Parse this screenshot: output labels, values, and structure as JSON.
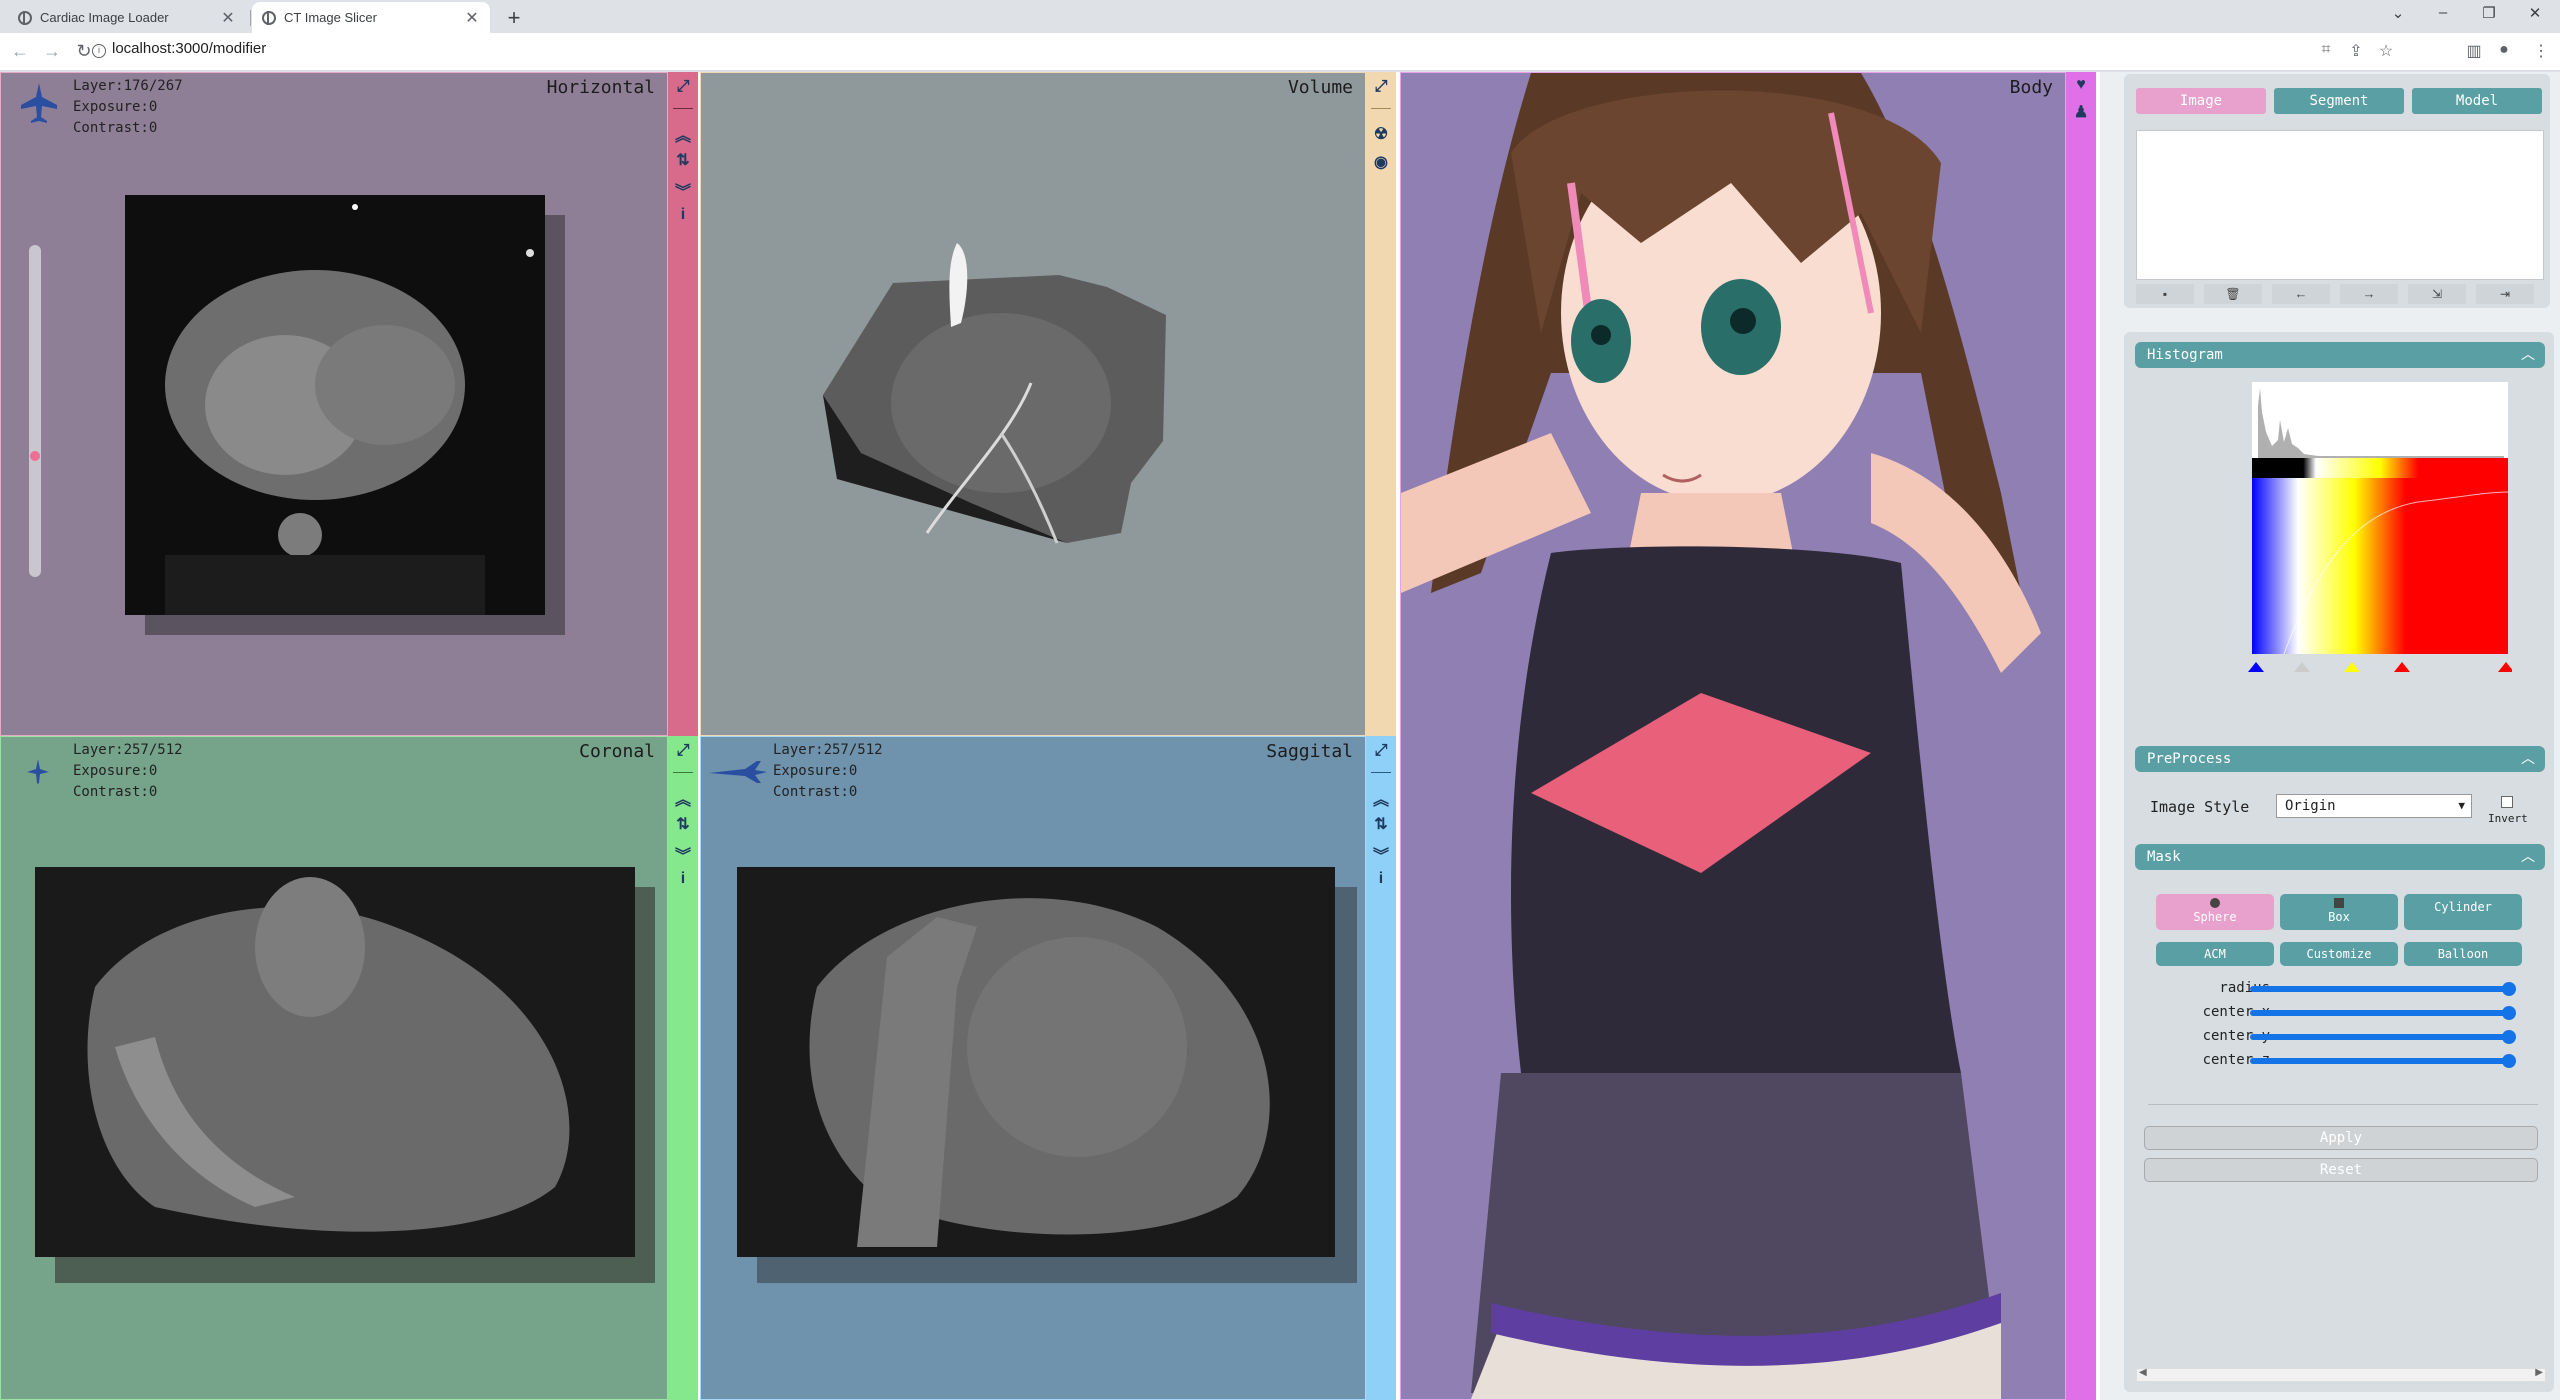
{
  "browser": {
    "tabs": [
      {
        "title": "Cardiac Image Loader",
        "active": false
      },
      {
        "title": "CT Image Slicer",
        "active": true
      }
    ],
    "url": "localhost:3000/modifier"
  },
  "panels": {
    "horizontal": {
      "title": "Horizontal",
      "layer": "Layer:176/267",
      "exposure": "Exposure:0",
      "contrast": "Contrast:0",
      "bg": "#8f7f96",
      "strip": "#d86a8c"
    },
    "volume": {
      "title": "Volume",
      "bg": "#8f989b",
      "strip": "#f2d8b0"
    },
    "coronal": {
      "title": "Coronal",
      "layer": "Layer:257/512",
      "exposure": "Exposure:0",
      "contrast": "Contrast:0",
      "bg": "#76a48a",
      "strip": "#86e88c"
    },
    "saggital": {
      "title": "Saggital",
      "layer": "Layer:257/512",
      "exposure": "Exposure:0",
      "contrast": "Contrast:0",
      "bg": "#6f92ad",
      "strip": "#8fd0f8"
    },
    "body": {
      "title": "Body",
      "bg": "#8f7fb2",
      "strip": "#e070e8"
    }
  },
  "right_panel": {
    "tabs": [
      "Image",
      "Segment",
      "Model"
    ],
    "histogram": {
      "title": "Histogram"
    },
    "preprocess": {
      "title": "PreProcess",
      "image_style_label": "Image Style",
      "image_style_value": "Origin",
      "invert_label": "Invert"
    },
    "mask": {
      "title": "Mask",
      "buttons": [
        "Sphere",
        "Box",
        "Cylinder",
        "ACM",
        "Customize",
        "Balloon"
      ],
      "sliders": [
        "radius",
        "center-x",
        "center-y",
        "center-z"
      ]
    },
    "apply_label": "Apply",
    "reset_label": "Reset"
  },
  "colors": {
    "teal": "#5a9fa3",
    "pink": "#e8a0cc",
    "slider_blue": "#1473e6"
  }
}
